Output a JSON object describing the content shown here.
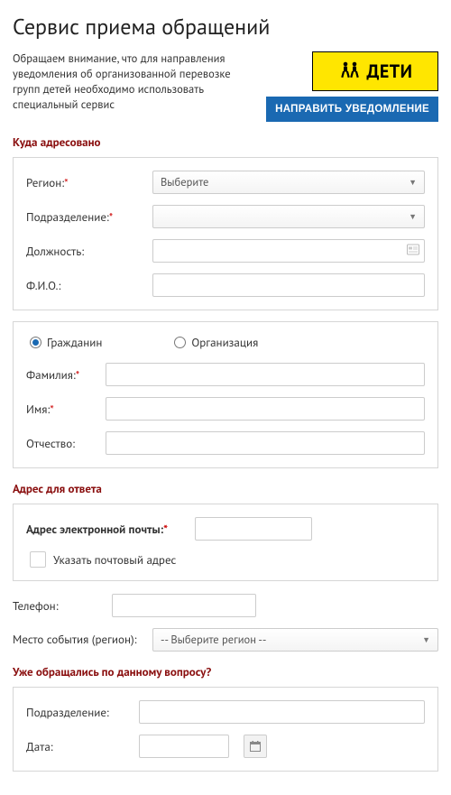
{
  "title": "Сервис приема обращений",
  "notice": "Обращаем внимание, что для направления уведомления об организованной перевозке групп детей необходимо использовать специальный сервис",
  "banner": {
    "label": "ДЕТИ"
  },
  "send_button": "НАПРАВИТЬ УВЕДОМЛЕНИЕ",
  "sections": {
    "dest": "Куда адресовано",
    "reply": "Адрес для ответа",
    "prev": "Уже обращались по данному вопросу?"
  },
  "dest": {
    "region_label": "Регион:",
    "region_value": "Выберите",
    "dept_label": "Подразделение:",
    "position_label": "Должность:",
    "fio_label": "Ф.И.О.:"
  },
  "applicant": {
    "radio_citizen": "Гражданин",
    "radio_org": "Организация",
    "lastname": "Фамилия:",
    "firstname": "Имя:",
    "patronymic": "Отчество:"
  },
  "reply": {
    "email_label": "Адрес электронной почты:",
    "postal_checkbox": "Указать почтовый адрес",
    "phone_label": "Телефон:",
    "event_region_label": "Место события (регион):",
    "event_region_value": "-- Выберите регион --"
  },
  "prev": {
    "dept_label": "Подразделение:",
    "date_label": "Дата:"
  }
}
